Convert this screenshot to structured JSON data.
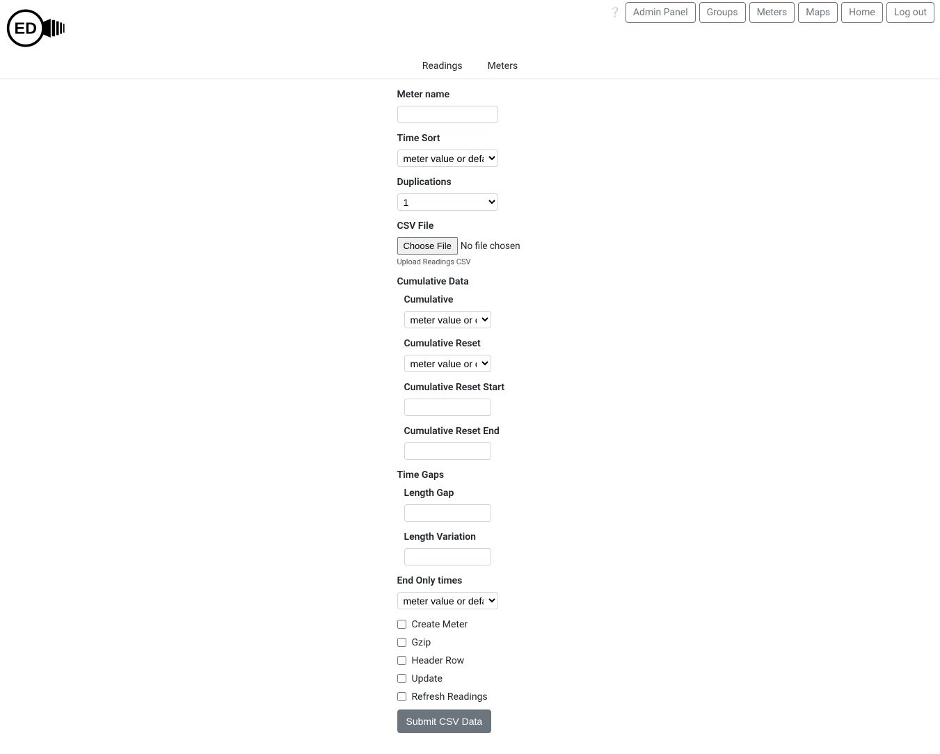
{
  "nav": {
    "admin": "Admin Panel",
    "groups": "Groups",
    "meters": "Meters",
    "maps": "Maps",
    "home": "Home",
    "logout": "Log out"
  },
  "tabs": {
    "readings": "Readings",
    "meters": "Meters"
  },
  "form": {
    "meter_name_label": "Meter name",
    "time_sort_label": "Time Sort",
    "time_sort_value": "meter value or default",
    "duplications_label": "Duplications",
    "duplications_value": "1",
    "csv_file_label": "CSV File",
    "choose_file_label": "Choose File",
    "no_file_chosen": "No file chosen",
    "upload_hint": "Upload Readings CSV",
    "cumulative_data_label": "Cumulative Data",
    "cumulative_label": "Cumulative",
    "cumulative_value": "meter value or def",
    "cumulative_reset_label": "Cumulative Reset",
    "cumulative_reset_value": "meter value or def",
    "cumulative_reset_start_label": "Cumulative Reset Start",
    "cumulative_reset_end_label": "Cumulative Reset End",
    "time_gaps_label": "Time Gaps",
    "length_gap_label": "Length Gap",
    "length_variation_label": "Length Variation",
    "end_only_times_label": "End Only times",
    "end_only_times_value": "meter value or default",
    "create_meter_label": "Create Meter",
    "gzip_label": "Gzip",
    "header_row_label": "Header Row",
    "update_label": "Update",
    "refresh_readings_label": "Refresh Readings",
    "submit_label": "Submit CSV Data"
  }
}
